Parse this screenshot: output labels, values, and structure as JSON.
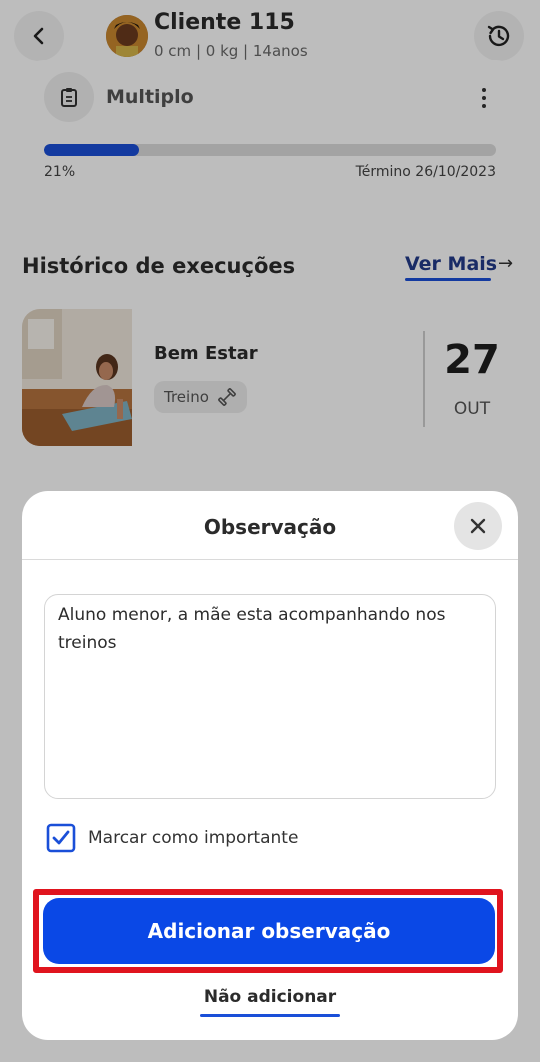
{
  "header": {
    "client_name": "Cliente 115",
    "client_meta": "0 cm |  0 kg |  14anos"
  },
  "program": {
    "title": "Multiplo",
    "progress_percent": 21,
    "progress_label": "21%",
    "end_label": "Término 26/10/2023"
  },
  "history": {
    "title": "Histórico de execuções",
    "see_more": "Ver Mais",
    "item": {
      "name": "Bem Estar",
      "tag": "Treino",
      "day": "27",
      "month": "OUT"
    }
  },
  "modal": {
    "title": "Observação",
    "note_text": "Aluno menor, a mãe esta acompanhando nos treinos",
    "checkbox_label": "Marcar como importante",
    "checkbox_checked": true,
    "primary_button": "Adicionar observação",
    "secondary_button": "Não adicionar"
  },
  "colors": {
    "accent": "#0a48e6",
    "highlight": "#e0141e",
    "link_underline": "#1a4fd8"
  }
}
